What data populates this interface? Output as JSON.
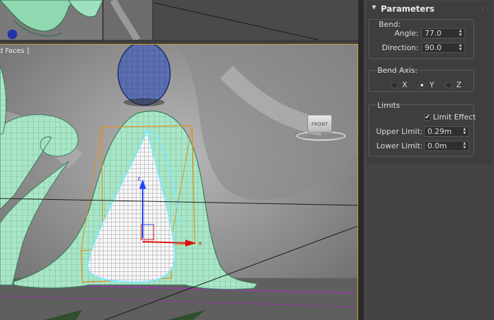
{
  "viewport": {
    "label": "d Faces ]",
    "viewcube_label": "FRONT"
  },
  "parameters": {
    "title": "Parameters",
    "bend": {
      "group_label": "Bend:",
      "angle_label": "Angle:",
      "angle_value": "77.0",
      "direction_label": "Direction:",
      "direction_value": "90.0"
    },
    "bend_axis": {
      "group_label": "Bend Axis:",
      "options": [
        "X",
        "Y",
        "Z"
      ],
      "selected": "Y"
    },
    "limits": {
      "group_label": "Limits",
      "limit_effect_label": "Limit Effect",
      "limit_effect_checked": true,
      "upper_limit_label": "Upper Limit:",
      "upper_limit_value": "0.29m",
      "lower_limit_label": "Lower Limit:",
      "lower_limit_value": "0.0m"
    }
  },
  "icons": {
    "rollout": "chevron-down-icon",
    "spinner": "spinner-arrows-icon",
    "checkbox": "checkmark-icon"
  },
  "colors": {
    "mesh": "#9fe0c0",
    "gizmo": "#e09020",
    "selection": "#7fe9ff",
    "viewport_border": "#c9a227"
  }
}
